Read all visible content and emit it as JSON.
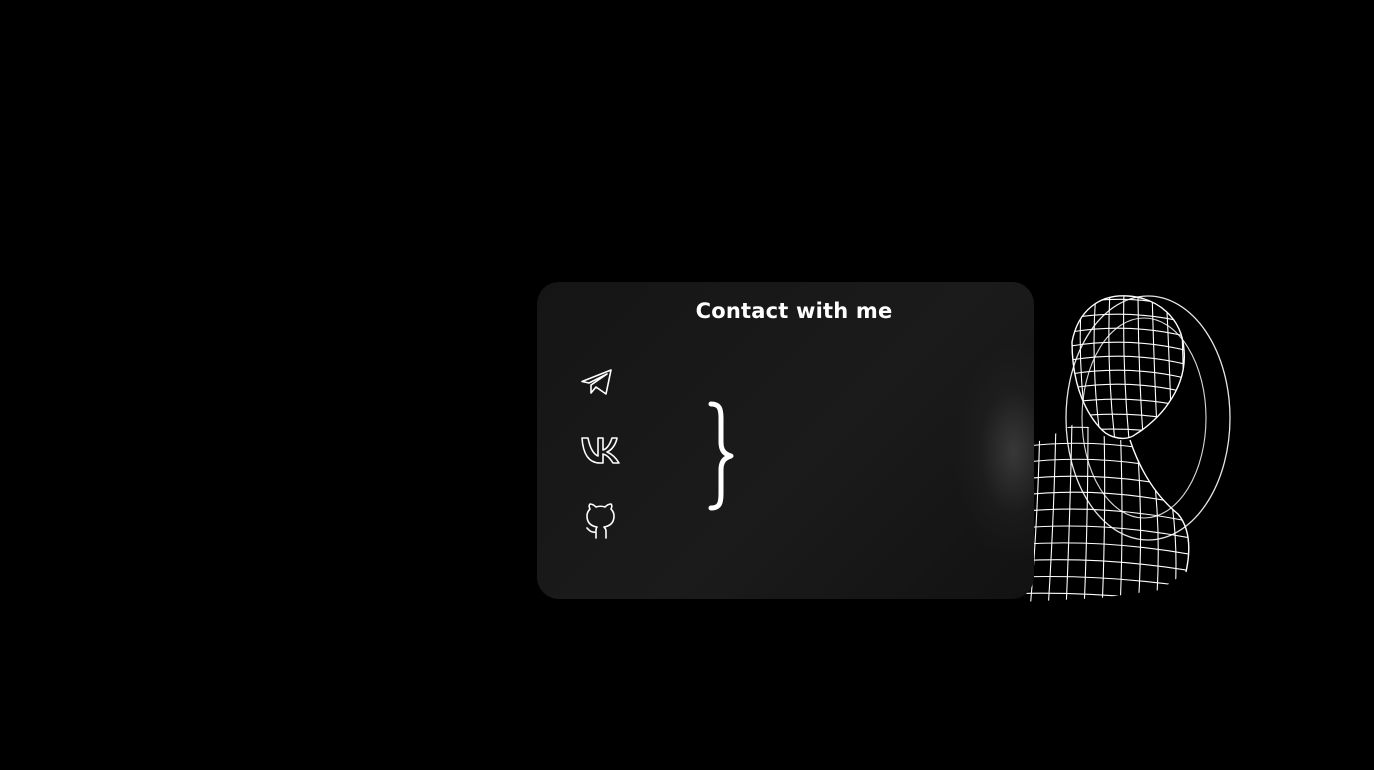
{
  "contact_card": {
    "title": "Contact with me"
  },
  "social_links": [
    {
      "name": "telegram",
      "icon": "telegram-icon"
    },
    {
      "name": "vk",
      "icon": "vk-icon"
    },
    {
      "name": "github",
      "icon": "github-icon"
    }
  ],
  "decorations": {
    "brace_icon": "curly-brace-icon",
    "figure": "wireframe-head-figure"
  },
  "colors": {
    "background": "#000000",
    "card": "#181818",
    "text": "#ffffff"
  }
}
